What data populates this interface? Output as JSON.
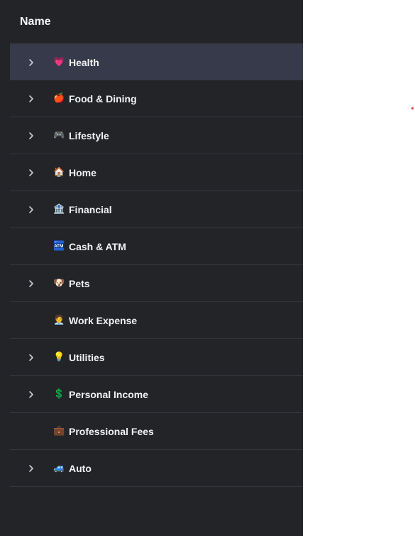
{
  "table": {
    "header": "Name",
    "rows": [
      {
        "label": "Health",
        "icon": "heart",
        "emoji": "💗",
        "color": "#ff4d8d",
        "expandable": true
      },
      {
        "label": "Food & Dining",
        "icon": "apple",
        "emoji": "🍎",
        "color": "#e53935",
        "expandable": true
      },
      {
        "label": "Lifestyle",
        "icon": "gamepad",
        "emoji": "🎮",
        "color": "#6c5ce7",
        "expandable": true
      },
      {
        "label": "Home",
        "icon": "house",
        "emoji": "🏠",
        "color": "#f08c3c",
        "expandable": true
      },
      {
        "label": "Financial",
        "icon": "bank",
        "emoji": "🏦",
        "color": "#9aa0a6",
        "expandable": true
      },
      {
        "label": "Cash & ATM",
        "icon": "atm",
        "emoji": "🏧",
        "color": "#3d8bfd",
        "expandable": false
      },
      {
        "label": "Pets",
        "icon": "dog",
        "emoji": "🐶",
        "color": "#d9822b",
        "expandable": true
      },
      {
        "label": "Work Expense",
        "icon": "office-worker",
        "emoji": "🧑‍💼",
        "color": "#4a6cf7",
        "expandable": false
      },
      {
        "label": "Utilities",
        "icon": "lightbulb",
        "emoji": "💡",
        "color": "#f5c518",
        "expandable": true
      },
      {
        "label": "Personal Income",
        "icon": "dollar-sign",
        "emoji": "💲",
        "color": "#2fb96a",
        "expandable": true
      },
      {
        "label": "Professional Fees",
        "icon": "briefcase",
        "emoji": "💼",
        "color": "#a0522d",
        "expandable": false
      },
      {
        "label": "Auto",
        "icon": "car",
        "emoji": "🚙",
        "color": "#e8554e",
        "expandable": true
      }
    ],
    "selected_index": 0
  },
  "colors": {
    "panel_bg": "#222428",
    "row_selected_bg": "#373a4a",
    "row_divider": "#34373d",
    "text": "#f1f2f4",
    "page_bg": "#ffffff"
  }
}
